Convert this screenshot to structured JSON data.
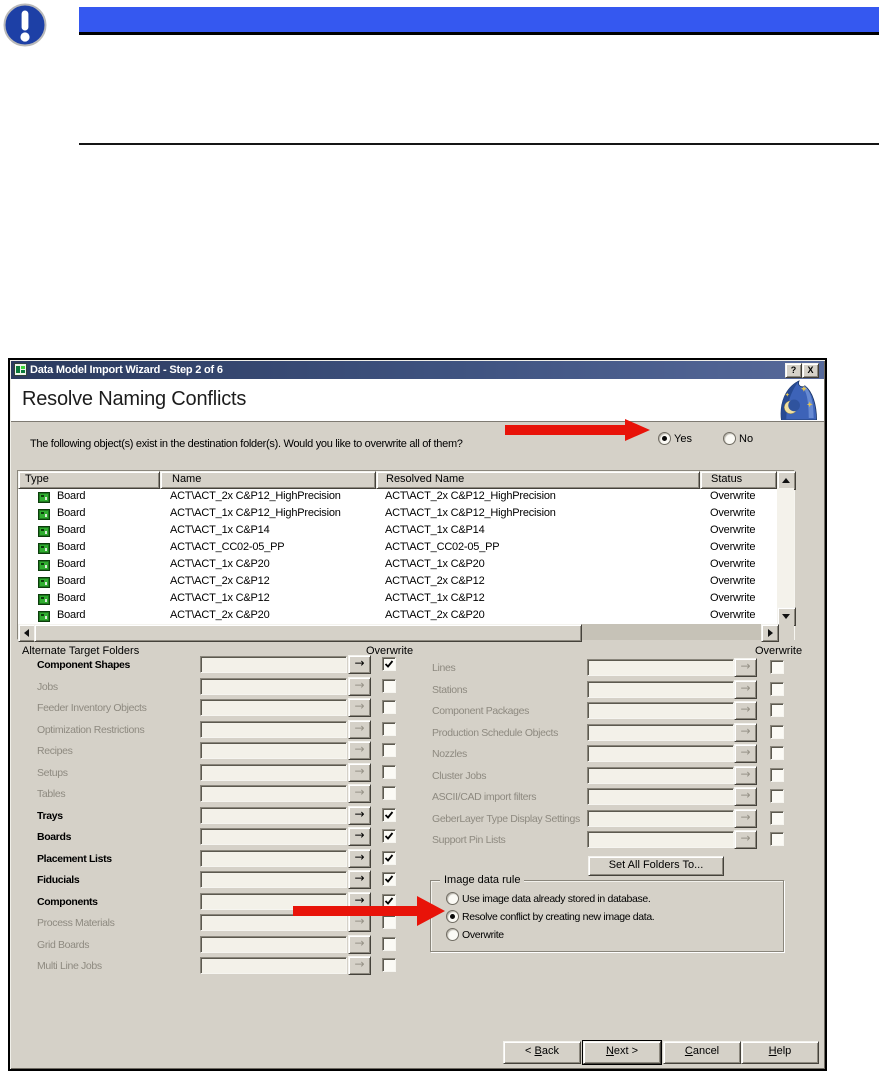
{
  "banner": {
    "icon": "warning-exclamation-icon",
    "bar_color": "#3558f0"
  },
  "dialog": {
    "title": "Data Model Import Wizard - Step 2 of 6",
    "titlebar": {
      "help_button": "?",
      "close_button": "X"
    },
    "heading": "Resolve Naming Conflicts",
    "instruction": "The following object(s) exist in the destination folder(s). Would you like to overwrite all of them?",
    "prompt": {
      "options": [
        {
          "label": "Yes",
          "selected": true
        },
        {
          "label": "No",
          "selected": false
        }
      ]
    },
    "table": {
      "columns": [
        "Type",
        "Name",
        "Resolved Name",
        "Status"
      ],
      "rows": [
        {
          "type": "Board",
          "name": "ACT\\ACT_2x C&P12_HighPrecision",
          "resolved": "ACT\\ACT_2x C&P12_HighPrecision",
          "status": "Overwrite"
        },
        {
          "type": "Board",
          "name": "ACT\\ACT_1x C&P12_HighPrecision",
          "resolved": "ACT\\ACT_1x C&P12_HighPrecision",
          "status": "Overwrite"
        },
        {
          "type": "Board",
          "name": "ACT\\ACT_1x C&P14",
          "resolved": "ACT\\ACT_1x C&P14",
          "status": "Overwrite"
        },
        {
          "type": "Board",
          "name": "ACT\\ACT_CC02-05_PP",
          "resolved": "ACT\\ACT_CC02-05_PP",
          "status": "Overwrite"
        },
        {
          "type": "Board",
          "name": "ACT\\ACT_1x C&P20",
          "resolved": "ACT\\ACT_1x C&P20",
          "status": "Overwrite"
        },
        {
          "type": "Board",
          "name": "ACT\\ACT_2x C&P12",
          "resolved": "ACT\\ACT_2x C&P12",
          "status": "Overwrite"
        },
        {
          "type": "Board",
          "name": "ACT\\ACT_1x C&P12",
          "resolved": "ACT\\ACT_1x C&P12",
          "status": "Overwrite"
        },
        {
          "type": "Board",
          "name": "ACT\\ACT_2x C&P20",
          "resolved": "ACT\\ACT_2x C&P20",
          "status": "Overwrite"
        }
      ]
    },
    "folders": {
      "section_label": "Alternate Target Folders",
      "overwrite_header": "Overwrite",
      "left": [
        {
          "label": "Component Shapes",
          "enabled": true,
          "checked": true
        },
        {
          "label": "Jobs",
          "enabled": false,
          "checked": false
        },
        {
          "label": "Feeder Inventory Objects",
          "enabled": false,
          "checked": false
        },
        {
          "label": "Optimization Restrictions",
          "enabled": false,
          "checked": false
        },
        {
          "label": "Recipes",
          "enabled": false,
          "checked": false
        },
        {
          "label": "Setups",
          "enabled": false,
          "checked": false
        },
        {
          "label": "Tables",
          "enabled": false,
          "checked": false
        },
        {
          "label": "Trays",
          "enabled": true,
          "checked": true
        },
        {
          "label": "Boards",
          "enabled": true,
          "checked": true
        },
        {
          "label": "Placement Lists",
          "enabled": true,
          "checked": true
        },
        {
          "label": "Fiducials",
          "enabled": true,
          "checked": true
        },
        {
          "label": "Components",
          "enabled": true,
          "checked": true
        },
        {
          "label": "Process Materials",
          "enabled": false,
          "checked": false
        },
        {
          "label": "Grid Boards",
          "enabled": false,
          "checked": false
        },
        {
          "label": "Multi Line Jobs",
          "enabled": false,
          "checked": false
        }
      ],
      "right": [
        {
          "label": "Lines",
          "enabled": false,
          "checked": false
        },
        {
          "label": "Stations",
          "enabled": false,
          "checked": false
        },
        {
          "label": "Component Packages",
          "enabled": false,
          "checked": false
        },
        {
          "label": "Production Schedule Objects",
          "enabled": false,
          "checked": false
        },
        {
          "label": "Nozzles",
          "enabled": false,
          "checked": false
        },
        {
          "label": "Cluster Jobs",
          "enabled": false,
          "checked": false
        },
        {
          "label": "ASCII/CAD import filters",
          "enabled": false,
          "checked": false
        },
        {
          "label": "GeberLayer Type Display Settings",
          "enabled": false,
          "checked": false
        },
        {
          "label": "Support Pin Lists",
          "enabled": false,
          "checked": false
        }
      ],
      "set_all_button": "Set All Folders To..."
    },
    "image_rule": {
      "group_label": "Image data rule",
      "options": [
        {
          "label": "Use image data already stored in database.",
          "selected": false
        },
        {
          "label": "Resolve conflict by creating new image data.",
          "selected": true
        },
        {
          "label": "Overwrite",
          "selected": false
        }
      ]
    },
    "footer": [
      {
        "label": "< Back",
        "mnemonic": "B",
        "default": false
      },
      {
        "label": "Next >",
        "mnemonic": "N",
        "default": true
      },
      {
        "label": "Cancel",
        "mnemonic": "C",
        "default": false
      },
      {
        "label": "Help",
        "mnemonic": "H",
        "default": false
      }
    ],
    "colors": {
      "callout_arrow": "#e81309",
      "titlebar_gradient": [
        "#2b3a5e",
        "#56699a"
      ],
      "dialog_bg": "#d5d1c8",
      "banner_blue": "#3558f0"
    }
  }
}
